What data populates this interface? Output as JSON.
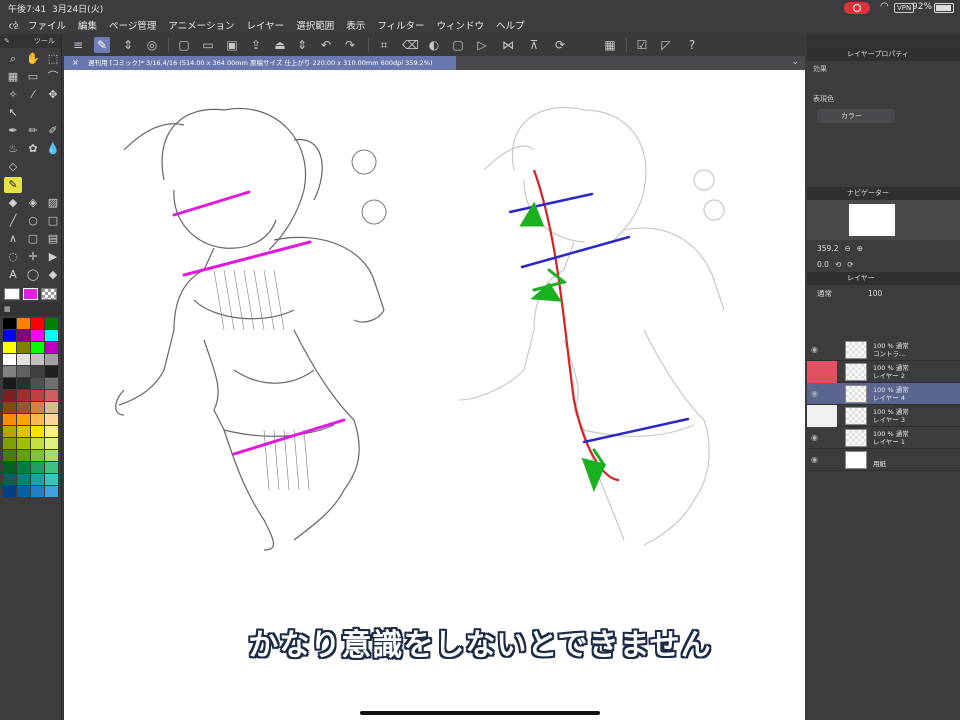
{
  "status": {
    "time": "午後7:41",
    "date": "3月24日(火)",
    "battery": "92%",
    "vpn": "VPN"
  },
  "menu": [
    "ファイル",
    "編集",
    "ページ管理",
    "アニメーション",
    "レイヤー",
    "選択範囲",
    "表示",
    "フィルター",
    "ウィンドウ",
    "ヘルプ"
  ],
  "tab": {
    "label": "週刊用 [コミック]* 3/16,4/16 (514.00 x 364.00mm 原稿サイズ 仕上がり 220.00 x 310.00mm 600dpi 359.2%)"
  },
  "left_panel": {
    "title": "ツール",
    "palette_colors": [
      "#000000",
      "#ff8000",
      "#ff0000",
      "#008000",
      "#0000ff",
      "#800080",
      "#ff00ff",
      "#00ffff",
      "#ffff00",
      "#808000",
      "#00ff00",
      "#c000c0",
      "#ffffff",
      "#e0e0e0",
      "#c0c0c0",
      "#a0a0a0",
      "#808080",
      "#606060",
      "#404040",
      "#202020",
      "#1a1a1a",
      "#303030",
      "#505050",
      "#707070",
      "#7a2020",
      "#a03030",
      "#c04040",
      "#d06060",
      "#8b4513",
      "#a0522d",
      "#cd853f",
      "#deb887",
      "#ff8c00",
      "#ffa500",
      "#ffb84d",
      "#ffd699",
      "#c0a000",
      "#e0c000",
      "#ffe000",
      "#fff080",
      "#80a000",
      "#a0c000",
      "#c0e040",
      "#e0f080",
      "#408000",
      "#60a020",
      "#80c040",
      "#a0e060",
      "#006020",
      "#008040",
      "#20a060",
      "#40c080",
      "#006060",
      "#008080",
      "#20a0a0",
      "#40c0c0",
      "#004080",
      "#0060a0",
      "#2080c0",
      "#40a0e0"
    ]
  },
  "right_panel": {
    "layer_property": "レイヤープロパティ",
    "effect_label": "効果",
    "expression_color_label": "表現色",
    "expression_color_value": "カラー",
    "navigator": "ナビゲーター",
    "zoom": "359.2",
    "rotation": "0.0",
    "layer_panel": "レイヤー",
    "blend_mode": "通常",
    "opacity": "100",
    "layers": [
      {
        "line1": "100 % 通常",
        "line2": "コントラ..."
      },
      {
        "line1": "100 % 通常",
        "line2": "レイヤー 2"
      },
      {
        "line1": "100 % 通常",
        "line2": "レイヤー 4"
      },
      {
        "line1": "100 % 通常",
        "line2": "レイヤー 3"
      },
      {
        "line1": "100 % 通常",
        "line2": "レイヤー 1"
      },
      {
        "line1": "",
        "line2": "用紙"
      }
    ]
  },
  "subtitle": "かなり意識をしないとできません"
}
